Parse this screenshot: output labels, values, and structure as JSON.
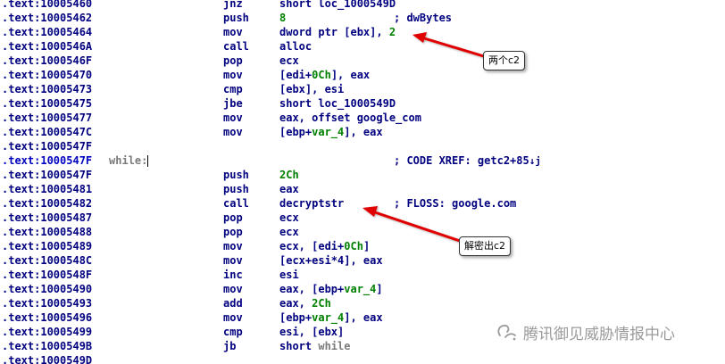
{
  "rows": [
    {
      "addr": ".text:10005460",
      "mnem": "jnz",
      "ops": [
        {
          "t": "short loc_1000549D"
        }
      ],
      "comment": ""
    },
    {
      "addr": ".text:10005462",
      "mnem": "push",
      "ops": [
        {
          "t": "8",
          "c": "num"
        }
      ],
      "comment": "; dwBytes"
    },
    {
      "addr": ".text:10005464",
      "mnem": "mov",
      "ops": [
        {
          "t": "dword ptr [ebx], "
        },
        {
          "t": "2",
          "c": "num"
        }
      ],
      "comment": ""
    },
    {
      "addr": ".text:1000546A",
      "mnem": "call",
      "ops": [
        {
          "t": "alloc"
        }
      ],
      "comment": ""
    },
    {
      "addr": ".text:1000546F",
      "mnem": "pop",
      "ops": [
        {
          "t": "ecx"
        }
      ],
      "comment": ""
    },
    {
      "addr": ".text:10005470",
      "mnem": "mov",
      "ops": [
        {
          "t": "[edi+"
        },
        {
          "t": "0Ch",
          "c": "num"
        },
        {
          "t": "], eax"
        }
      ],
      "comment": ""
    },
    {
      "addr": ".text:10005473",
      "mnem": "cmp",
      "ops": [
        {
          "t": "[ebx], esi"
        }
      ],
      "comment": ""
    },
    {
      "addr": ".text:10005475",
      "mnem": "jbe",
      "ops": [
        {
          "t": "short loc_1000549D"
        }
      ],
      "comment": ""
    },
    {
      "addr": ".text:10005477",
      "mnem": "mov",
      "ops": [
        {
          "t": "eax, offset google_com"
        }
      ],
      "comment": ""
    },
    {
      "addr": ".text:1000547C",
      "mnem": "mov",
      "ops": [
        {
          "t": "[ebp+"
        },
        {
          "t": "var_4",
          "c": "var"
        },
        {
          "t": "], eax"
        }
      ],
      "comment": ""
    },
    {
      "addr": ".text:1000547F",
      "mnem": "",
      "ops": [],
      "comment": ""
    },
    {
      "addr": ".text:1000547F",
      "label": "while:",
      "mnem": "",
      "ops": [],
      "comment": "; CODE XREF: getc2+85",
      "xref_arrow": "↓j",
      "highlight": true
    },
    {
      "addr": ".text:1000547F",
      "mnem": "push",
      "ops": [
        {
          "t": "2Ch",
          "c": "num"
        }
      ],
      "comment": ""
    },
    {
      "addr": ".text:10005481",
      "mnem": "push",
      "ops": [
        {
          "t": "eax"
        }
      ],
      "comment": ""
    },
    {
      "addr": ".text:10005482",
      "mnem": "call",
      "ops": [
        {
          "t": "decryptstr"
        }
      ],
      "comment": "; FLOSS: google.com"
    },
    {
      "addr": ".text:10005487",
      "mnem": "pop",
      "ops": [
        {
          "t": "ecx"
        }
      ],
      "comment": ""
    },
    {
      "addr": ".text:10005488",
      "mnem": "pop",
      "ops": [
        {
          "t": "ecx"
        }
      ],
      "comment": ""
    },
    {
      "addr": ".text:10005489",
      "mnem": "mov",
      "ops": [
        {
          "t": "ecx, [edi+"
        },
        {
          "t": "0Ch",
          "c": "num"
        },
        {
          "t": "]"
        }
      ],
      "comment": ""
    },
    {
      "addr": ".text:1000548C",
      "mnem": "mov",
      "ops": [
        {
          "t": "[ecx+esi*4], eax"
        }
      ],
      "comment": ""
    },
    {
      "addr": ".text:1000548F",
      "mnem": "inc",
      "ops": [
        {
          "t": "esi"
        }
      ],
      "comment": ""
    },
    {
      "addr": ".text:10005490",
      "mnem": "mov",
      "ops": [
        {
          "t": "eax, [ebp+"
        },
        {
          "t": "var_4",
          "c": "var"
        },
        {
          "t": "]"
        }
      ],
      "comment": ""
    },
    {
      "addr": ".text:10005493",
      "mnem": "add",
      "ops": [
        {
          "t": "eax, "
        },
        {
          "t": "2Ch",
          "c": "num"
        }
      ],
      "comment": ""
    },
    {
      "addr": ".text:10005496",
      "mnem": "mov",
      "ops": [
        {
          "t": "[ebp+"
        },
        {
          "t": "var_4",
          "c": "var"
        },
        {
          "t": "], eax"
        }
      ],
      "comment": ""
    },
    {
      "addr": ".text:10005499",
      "mnem": "cmp",
      "ops": [
        {
          "t": "esi, [ebx]"
        }
      ],
      "comment": ""
    },
    {
      "addr": ".text:1000549B",
      "mnem": "jb",
      "ops": [
        {
          "t": "short "
        },
        {
          "t": "while",
          "c": "lbl"
        }
      ],
      "comment": ""
    },
    {
      "addr": ".text:1000549D",
      "mnem": "",
      "ops": [],
      "comment": ""
    }
  ],
  "callouts": {
    "first": "两个c2",
    "second": "解密出c2"
  },
  "watermark": {
    "text": "腾讯御见威胁情报中心",
    "icon": "wechat-channel-icon"
  },
  "colors": {
    "address": "#000080",
    "instruction": "#000080",
    "number": "#008000",
    "label": "#7a7a7a",
    "arrow": "#e00000",
    "watermark": "#9a9a9a"
  }
}
